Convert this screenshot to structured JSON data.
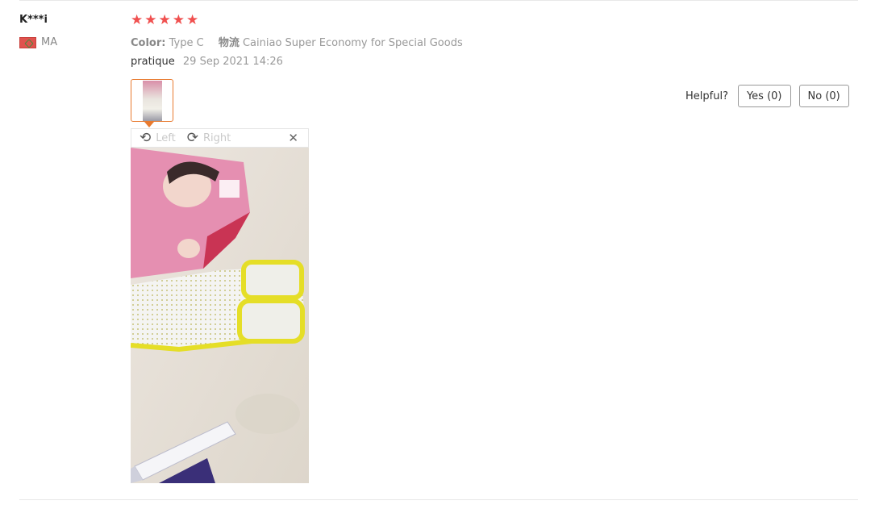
{
  "review": {
    "username": "K***i",
    "country_code": "MA",
    "rating": 5,
    "stars": [
      "★",
      "★",
      "★",
      "★",
      "★"
    ],
    "star_color": "#f0504f",
    "attributes": [
      {
        "key": "Color:",
        "value": "Type C"
      },
      {
        "key": "物流",
        "value": "Cainiao Super Economy for Special Goods"
      }
    ],
    "comment": "pratique",
    "date": "29 Sep 2021 14:26"
  },
  "viewer": {
    "rotate_left_icon": "rotate-left-icon",
    "rotate_left_label": "Left",
    "rotate_right_icon": "rotate-right-icon",
    "rotate_right_label": "Right",
    "close_icon": "close-icon",
    "accent": "#e87a2f"
  },
  "helpful": {
    "label": "Helpful?",
    "yes": "Yes (0)",
    "no": "No (0)"
  }
}
